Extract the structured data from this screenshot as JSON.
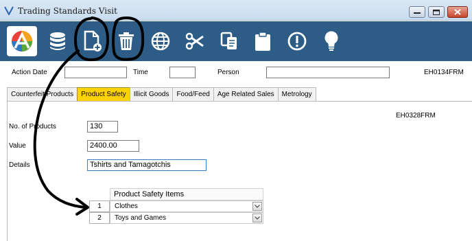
{
  "window": {
    "title": "Trading Standards Visit"
  },
  "toolbar": {
    "tools": [
      "app-logo",
      "database-icon",
      "new-document-icon",
      "trash-icon",
      "globe-icon",
      "scissors-icon",
      "copy-icon",
      "clipboard-icon",
      "alert-icon",
      "lightbulb-icon"
    ]
  },
  "header": {
    "action_date_label": "Action Date",
    "action_date_value": "",
    "time_label": "Time",
    "time_value": "",
    "person_label": "Person",
    "person_value": "",
    "form_code": "EH0134FRM"
  },
  "tabs": [
    {
      "label": "Counterfeit Products",
      "active": false
    },
    {
      "label": "Product Safety",
      "active": true
    },
    {
      "label": "Illicit Goods",
      "active": false
    },
    {
      "label": "Food/Feed",
      "active": false
    },
    {
      "label": "Age Related Sales",
      "active": false
    },
    {
      "label": "Metrology",
      "active": false
    }
  ],
  "panel": {
    "form_code": "EH0328FRM",
    "num_products_label": "No. of Products",
    "num_products_value": "130",
    "value_label": "Value",
    "value_value": "2400.00",
    "details_label": "Details",
    "details_value": "Tshirts and Tamagotchis"
  },
  "grid": {
    "header": "Product Safety Items",
    "rows": [
      {
        "num": "1",
        "value": "Clothes"
      },
      {
        "num": "2",
        "value": "Toys and Games"
      }
    ]
  },
  "colors": {
    "toolbar_bg": "#2d5d86",
    "active_tab": "#ffd200",
    "annotation_ink": "#000000"
  }
}
